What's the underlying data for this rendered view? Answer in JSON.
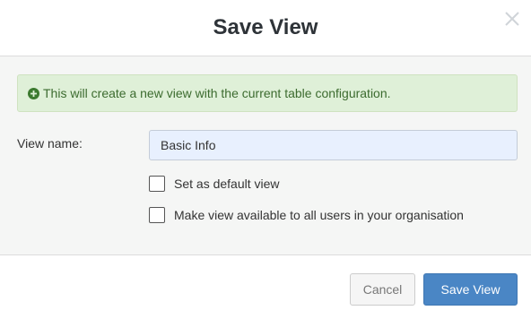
{
  "dialog": {
    "title": "Save View",
    "close_icon": "close-icon"
  },
  "alert": {
    "icon": "plus-circle-icon",
    "message": "This will create a new view with the current table configuration.",
    "color": "#dff0d8"
  },
  "form": {
    "view_name_label": "View name:",
    "view_name_value": "Basic Info",
    "default_view_label": "Set as default view",
    "default_view_checked": false,
    "shared_label": "Make view available to all users in your organisation",
    "shared_checked": false
  },
  "footer": {
    "cancel_label": "Cancel",
    "save_label": "Save View",
    "save_color": "#4a86c5"
  }
}
